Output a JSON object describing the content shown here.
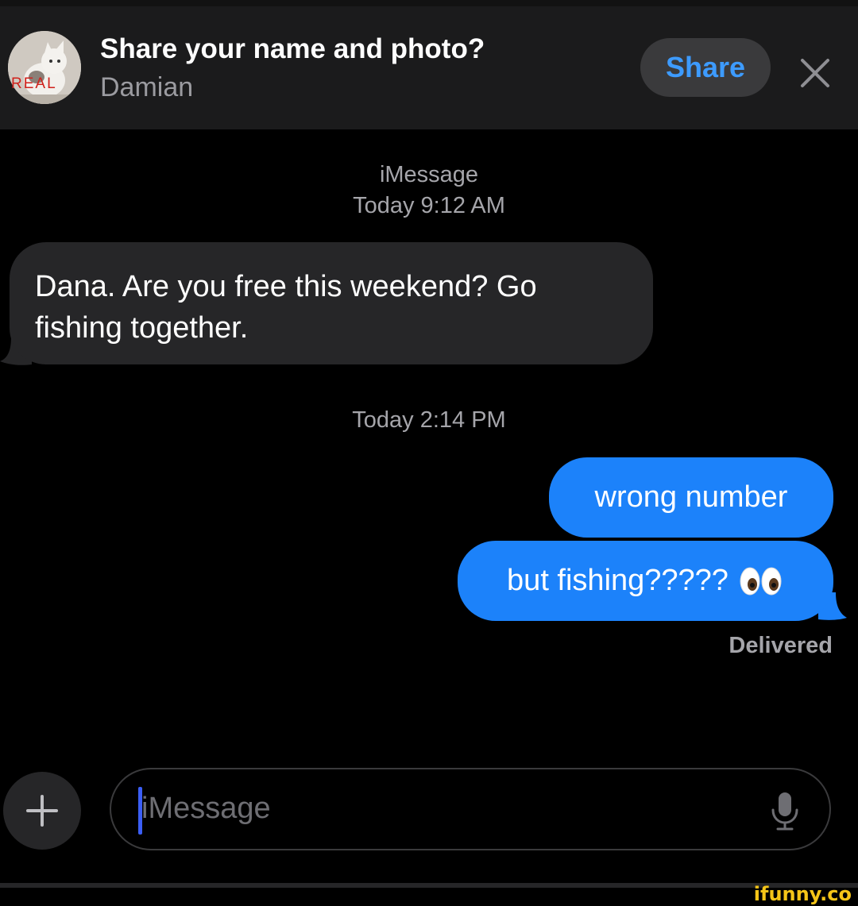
{
  "banner": {
    "title": "Share your name and photo?",
    "name": "Damian",
    "avatar_label": "REAL",
    "share_label": "Share",
    "close_icon": "close-icon"
  },
  "conversation": {
    "service": "iMessage",
    "timestamp_1": "Today 9:12 AM",
    "incoming_message": "Dana. Are you free this weekend? Go fishing together.",
    "timestamp_2": "Today 2:14 PM",
    "outgoing_messages": [
      {
        "text": "wrong number"
      },
      {
        "text": "but fishing?????",
        "emoji": "eyes-emoji"
      }
    ],
    "status": "Delivered"
  },
  "composer": {
    "placeholder": "iMessage",
    "plus_icon": "plus-icon",
    "mic_icon": "microphone-icon"
  },
  "watermark": "ifunny.co",
  "colors": {
    "background": "#000000",
    "banner": "#1b1b1c",
    "incoming_bubble": "#262628",
    "outgoing_bubble": "#1c82fa",
    "accent": "#3d9bff",
    "caret": "#3b5ef5"
  }
}
